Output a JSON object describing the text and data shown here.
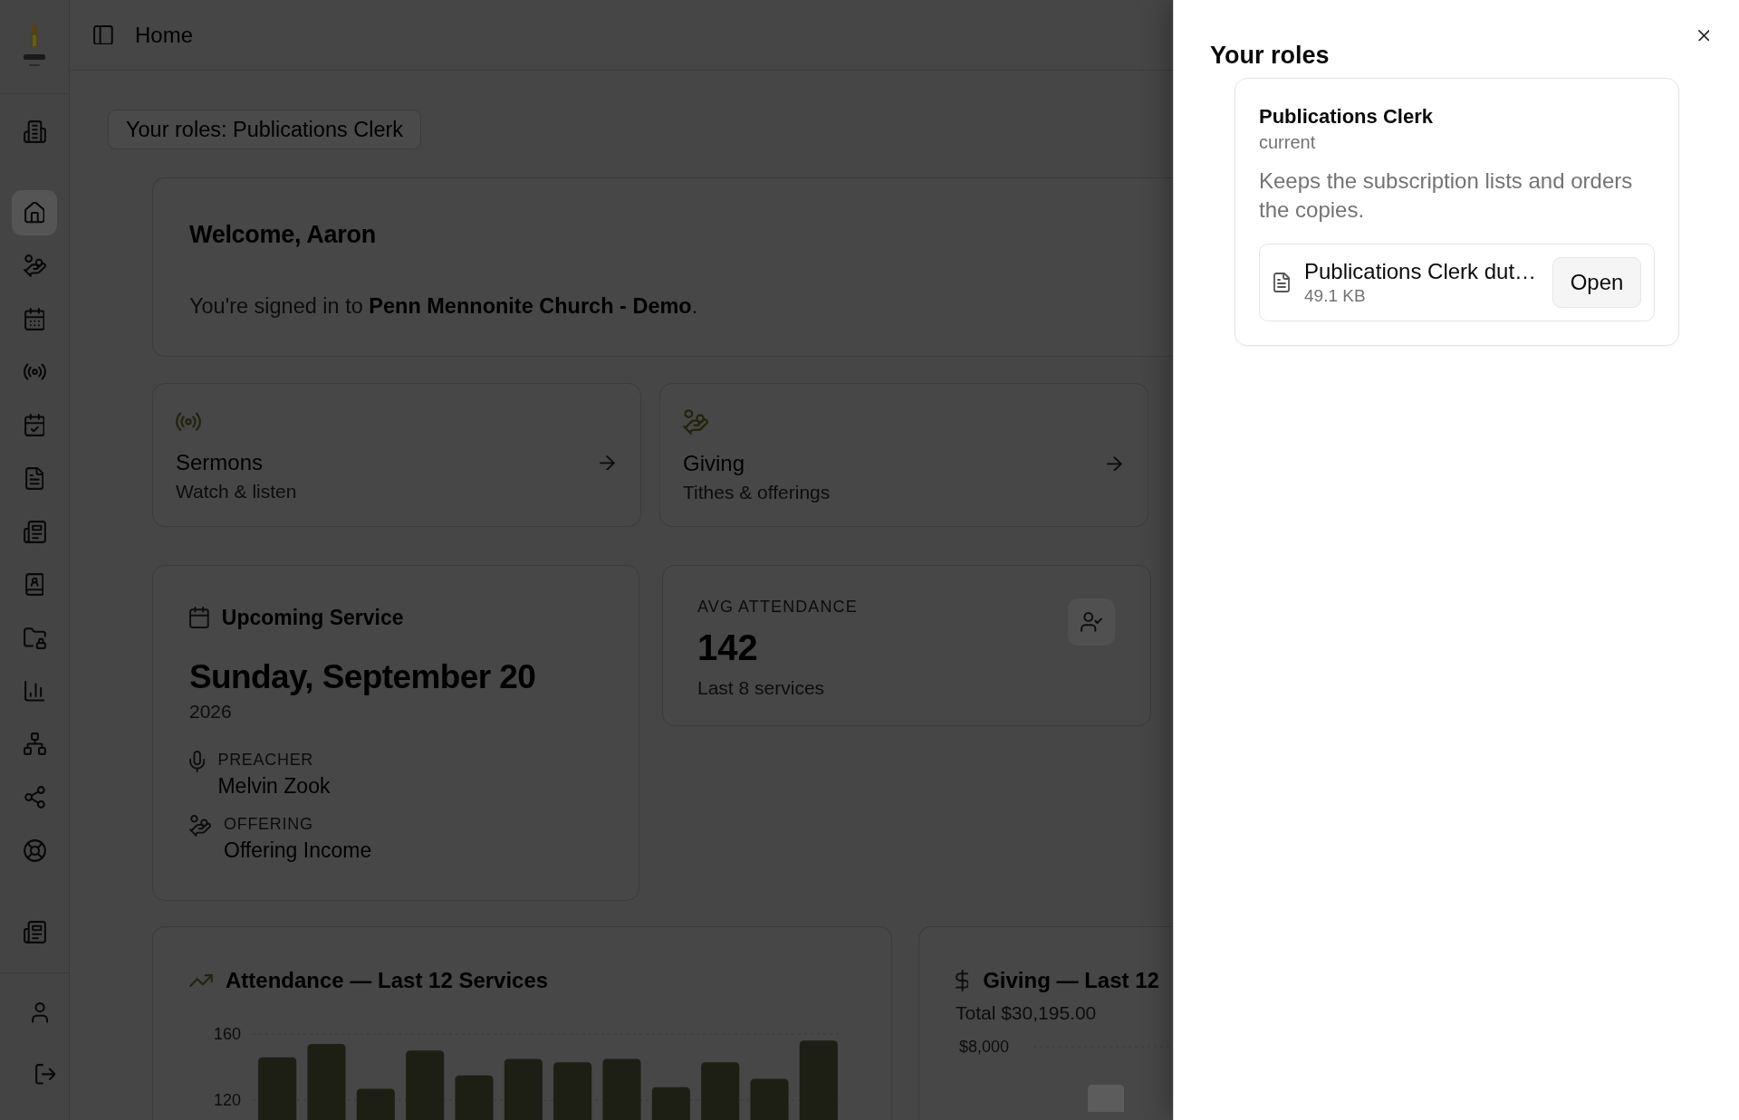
{
  "sidebar": {
    "items": [
      {
        "selected": true
      },
      {
        "selected": false
      },
      {
        "selected": false
      },
      {
        "selected": false
      },
      {
        "selected": false
      },
      {
        "selected": false
      },
      {
        "selected": false
      },
      {
        "selected": false
      },
      {
        "selected": false
      },
      {
        "selected": false
      },
      {
        "selected": false
      },
      {
        "selected": false
      },
      {
        "selected": false
      }
    ]
  },
  "header": {
    "title": "Home"
  },
  "roles_button": {
    "label": "Your roles: Publications Clerk"
  },
  "welcome": {
    "heading": "Welcome, Aaron",
    "message": "You're signed in to **Penn Mennonite Church - Demo**."
  },
  "quick_links": [
    {
      "title": "Sermons",
      "subtitle": "Watch & listen"
    },
    {
      "title": "Giving",
      "subtitle": "Tithes & offerings"
    }
  ],
  "upcoming_service": {
    "heading": "Upcoming Service",
    "date": "Sunday, September 20",
    "year": "2026",
    "details": [
      {
        "label": "PREACHER",
        "value": "Melvin Zook"
      },
      {
        "label": "OFFERING",
        "value": "Offering Income"
      }
    ]
  },
  "avg_attendance": {
    "label": "AVG ATTENDANCE",
    "value": "142",
    "caption": "Last 8 services"
  },
  "attendance_chart": {
    "chart_data": {
      "type": "bar",
      "title": "Attendance — Last 12 Services",
      "ylim": [
        106,
        160
      ],
      "yticks": [
        120,
        160
      ],
      "values": [
        146,
        154,
        127,
        150,
        135,
        145,
        143,
        145,
        128,
        143,
        133,
        156
      ]
    }
  },
  "giving_chart": {
    "title": "Giving — Last 12",
    "total": "Total $30,195.00",
    "y_tick": "$8,000"
  },
  "roles_panel": {
    "title": "Your roles",
    "roles": [
      {
        "name": "Publications Clerk",
        "status": "current",
        "description": "Keeps the subscription lists and orders the copies.",
        "documents": [
          {
            "name": "Publications Clerk dut…",
            "size": "49.1 KB",
            "action": "Open"
          }
        ]
      }
    ]
  }
}
